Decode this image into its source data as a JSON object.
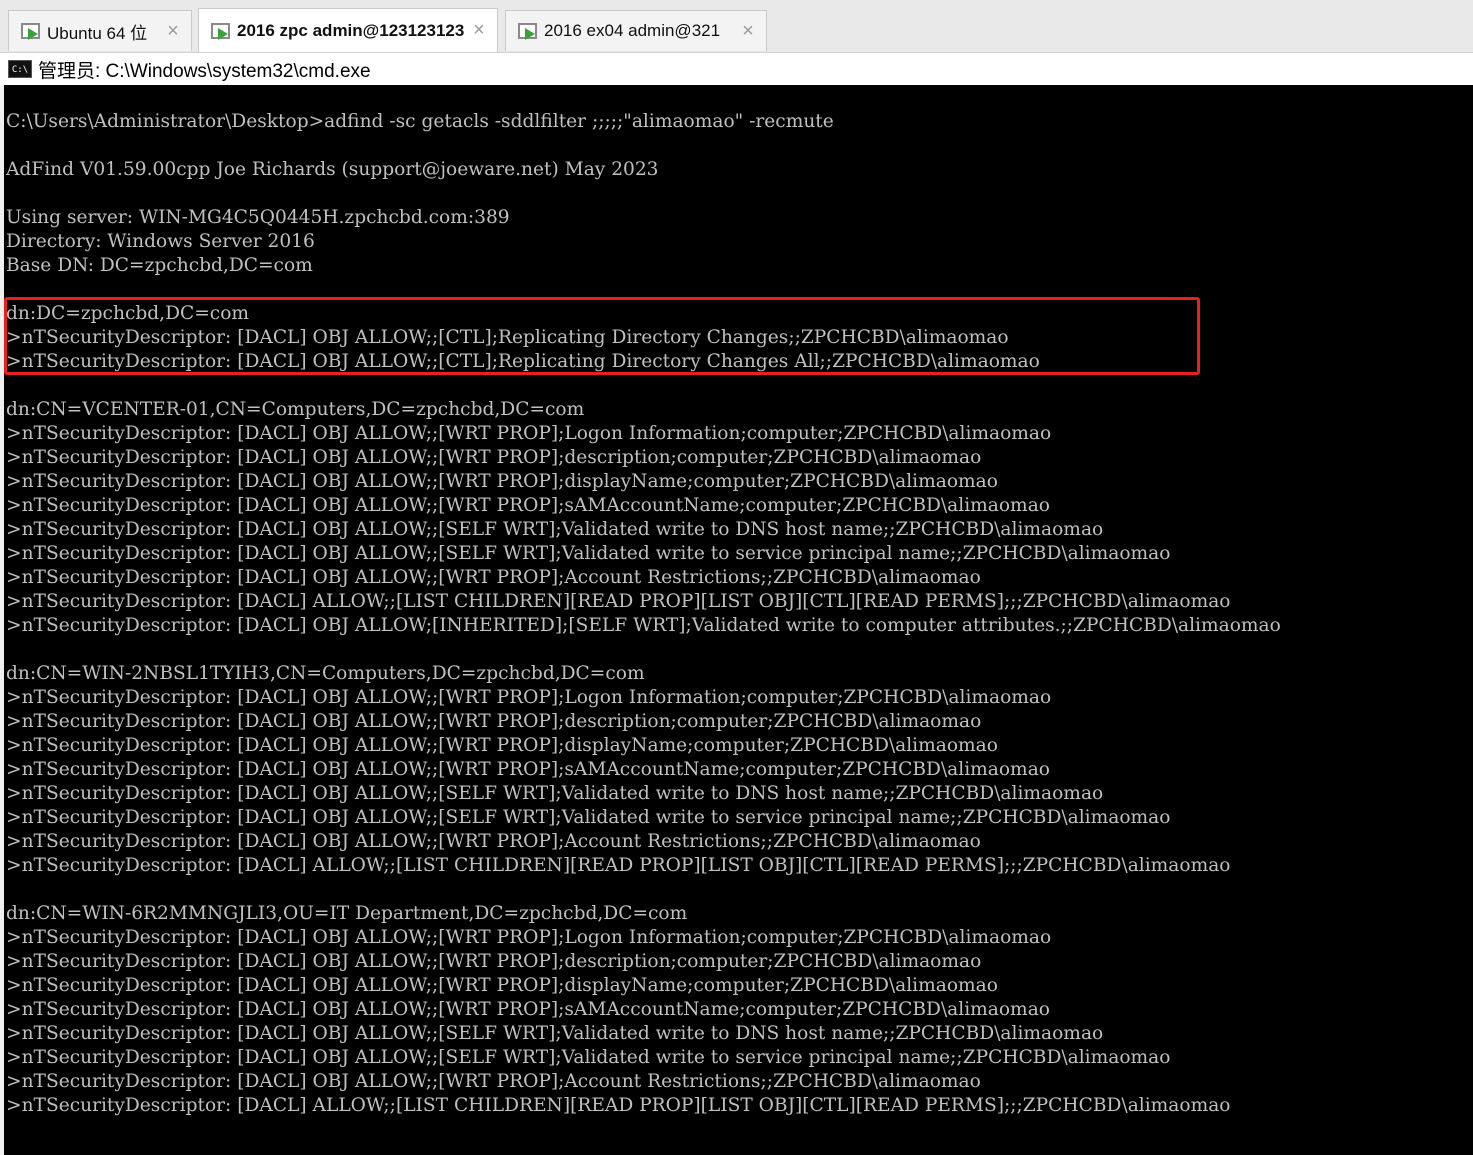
{
  "tabs": [
    {
      "label": "Ubuntu 64 位"
    },
    {
      "label": "2016 zpc admin@123123123"
    },
    {
      "label": "2016 ex04 admin@321"
    }
  ],
  "window": {
    "title": "管理员: C:\\Windows\\system32\\cmd.exe",
    "icon_text": "C:\\"
  },
  "console": {
    "lines": [
      "C:\\Users\\Administrator\\Desktop>adfind -sc getacls -sddlfilter ;;;;;\"alimaomao\" -recmute",
      "",
      "AdFind V01.59.00cpp Joe Richards (support@joeware.net) May 2023",
      "",
      "Using server: WIN-MG4C5Q0445H.zpchcbd.com:389",
      "Directory: Windows Server 2016",
      "Base DN: DC=zpchcbd,DC=com",
      "",
      "dn:DC=zpchcbd,DC=com",
      ">nTSecurityDescriptor: [DACL] OBJ ALLOW;;[CTL];Replicating Directory Changes;;ZPCHCBD\\alimaomao",
      ">nTSecurityDescriptor: [DACL] OBJ ALLOW;;[CTL];Replicating Directory Changes All;;ZPCHCBD\\alimaomao",
      "",
      "dn:CN=VCENTER-01,CN=Computers,DC=zpchcbd,DC=com",
      ">nTSecurityDescriptor: [DACL] OBJ ALLOW;;[WRT PROP];Logon Information;computer;ZPCHCBD\\alimaomao",
      ">nTSecurityDescriptor: [DACL] OBJ ALLOW;;[WRT PROP];description;computer;ZPCHCBD\\alimaomao",
      ">nTSecurityDescriptor: [DACL] OBJ ALLOW;;[WRT PROP];displayName;computer;ZPCHCBD\\alimaomao",
      ">nTSecurityDescriptor: [DACL] OBJ ALLOW;;[WRT PROP];sAMAccountName;computer;ZPCHCBD\\alimaomao",
      ">nTSecurityDescriptor: [DACL] OBJ ALLOW;;[SELF WRT];Validated write to DNS host name;;ZPCHCBD\\alimaomao",
      ">nTSecurityDescriptor: [DACL] OBJ ALLOW;;[SELF WRT];Validated write to service principal name;;ZPCHCBD\\alimaomao",
      ">nTSecurityDescriptor: [DACL] OBJ ALLOW;;[WRT PROP];Account Restrictions;;ZPCHCBD\\alimaomao",
      ">nTSecurityDescriptor: [DACL] ALLOW;;[LIST CHILDREN][READ PROP][LIST OBJ][CTL][READ PERMS];;;ZPCHCBD\\alimaomao",
      ">nTSecurityDescriptor: [DACL] OBJ ALLOW;[INHERITED];[SELF WRT];Validated write to computer attributes.;;ZPCHCBD\\alimaomao",
      "",
      "dn:CN=WIN-2NBSL1TYIH3,CN=Computers,DC=zpchcbd,DC=com",
      ">nTSecurityDescriptor: [DACL] OBJ ALLOW;;[WRT PROP];Logon Information;computer;ZPCHCBD\\alimaomao",
      ">nTSecurityDescriptor: [DACL] OBJ ALLOW;;[WRT PROP];description;computer;ZPCHCBD\\alimaomao",
      ">nTSecurityDescriptor: [DACL] OBJ ALLOW;;[WRT PROP];displayName;computer;ZPCHCBD\\alimaomao",
      ">nTSecurityDescriptor: [DACL] OBJ ALLOW;;[WRT PROP];sAMAccountName;computer;ZPCHCBD\\alimaomao",
      ">nTSecurityDescriptor: [DACL] OBJ ALLOW;;[SELF WRT];Validated write to DNS host name;;ZPCHCBD\\alimaomao",
      ">nTSecurityDescriptor: [DACL] OBJ ALLOW;;[SELF WRT];Validated write to service principal name;;ZPCHCBD\\alimaomao",
      ">nTSecurityDescriptor: [DACL] OBJ ALLOW;;[WRT PROP];Account Restrictions;;ZPCHCBD\\alimaomao",
      ">nTSecurityDescriptor: [DACL] ALLOW;;[LIST CHILDREN][READ PROP][LIST OBJ][CTL][READ PERMS];;;ZPCHCBD\\alimaomao",
      "",
      "dn:CN=WIN-6R2MMNGJLI3,OU=IT Department,DC=zpchcbd,DC=com",
      ">nTSecurityDescriptor: [DACL] OBJ ALLOW;;[WRT PROP];Logon Information;computer;ZPCHCBD\\alimaomao",
      ">nTSecurityDescriptor: [DACL] OBJ ALLOW;;[WRT PROP];description;computer;ZPCHCBD\\alimaomao",
      ">nTSecurityDescriptor: [DACL] OBJ ALLOW;;[WRT PROP];displayName;computer;ZPCHCBD\\alimaomao",
      ">nTSecurityDescriptor: [DACL] OBJ ALLOW;;[WRT PROP];sAMAccountName;computer;ZPCHCBD\\alimaomao",
      ">nTSecurityDescriptor: [DACL] OBJ ALLOW;;[SELF WRT];Validated write to DNS host name;;ZPCHCBD\\alimaomao",
      ">nTSecurityDescriptor: [DACL] OBJ ALLOW;;[SELF WRT];Validated write to service principal name;;ZPCHCBD\\alimaomao",
      ">nTSecurityDescriptor: [DACL] OBJ ALLOW;;[WRT PROP];Account Restrictions;;ZPCHCBD\\alimaomao",
      ">nTSecurityDescriptor: [DACL] ALLOW;;[LIST CHILDREN][READ PROP][LIST OBJ][CTL][READ PERMS];;;ZPCHCBD\\alimaomao"
    ]
  },
  "colors": {
    "console_bg": "#000000",
    "console_text": "#c0c0c0",
    "highlight_border": "#e8201e"
  }
}
